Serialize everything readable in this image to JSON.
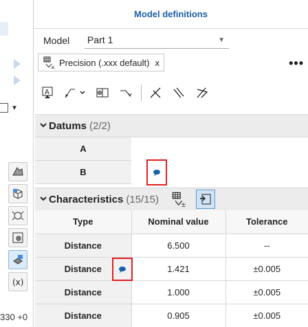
{
  "panel": {
    "title": "Model definitions",
    "model_label": "Model",
    "model_value": "Part 1",
    "chip_label": "Precision (.xxx default)",
    "chip_close": "x",
    "more": "•••"
  },
  "datums": {
    "title": "Datums",
    "count": "(2/2)",
    "rows": [
      "A",
      "B"
    ]
  },
  "characteristics": {
    "title": "Characteristics",
    "count": "(15/15)",
    "headers": [
      "Type",
      "Nominal value",
      "Tolerance"
    ],
    "rows": [
      {
        "type": "Distance",
        "nominal": "6.500",
        "tolerance": "--"
      },
      {
        "type": "Distance",
        "nominal": "1.421",
        "tolerance": "±0.005"
      },
      {
        "type": "Distance",
        "nominal": "1.000",
        "tolerance": "±0.005"
      },
      {
        "type": "Distance",
        "nominal": "0.905",
        "tolerance": "±0.005"
      }
    ]
  },
  "cad": {
    "fragment_text": "330 +0"
  },
  "colors": {
    "accent": "#1b5fa8",
    "highlight": "#e02020",
    "section_bg": "#ececec"
  }
}
